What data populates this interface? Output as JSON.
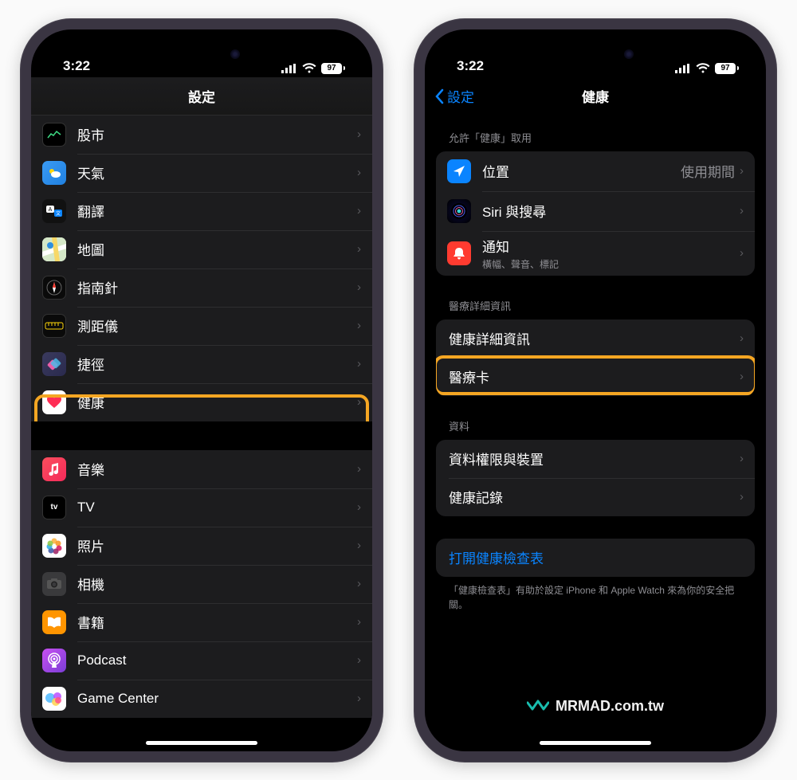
{
  "status": {
    "time": "3:22",
    "battery": "97"
  },
  "left": {
    "title": "設定",
    "group1": [
      {
        "id": "stocks",
        "label": "股市",
        "icon": "stocks"
      },
      {
        "id": "weather",
        "label": "天氣",
        "icon": "weather"
      },
      {
        "id": "translate",
        "label": "翻譯",
        "icon": "translate"
      },
      {
        "id": "maps",
        "label": "地圖",
        "icon": "maps"
      },
      {
        "id": "compass",
        "label": "指南針",
        "icon": "compass"
      },
      {
        "id": "measure",
        "label": "測距儀",
        "icon": "measure"
      },
      {
        "id": "shortcuts",
        "label": "捷徑",
        "icon": "shortcuts"
      },
      {
        "id": "health",
        "label": "健康",
        "icon": "health",
        "highlight": true
      }
    ],
    "group2": [
      {
        "id": "music",
        "label": "音樂",
        "icon": "music"
      },
      {
        "id": "tv",
        "label": "TV",
        "icon": "tv"
      },
      {
        "id": "photos",
        "label": "照片",
        "icon": "photos"
      },
      {
        "id": "camera",
        "label": "相機",
        "icon": "camera"
      },
      {
        "id": "books",
        "label": "書籍",
        "icon": "books"
      },
      {
        "id": "podcast",
        "label": "Podcast",
        "icon": "podcast"
      },
      {
        "id": "gamecenter",
        "label": "Game Center",
        "icon": "gamecenter"
      }
    ]
  },
  "right": {
    "back": "設定",
    "title": "健康",
    "section1": {
      "header": "允許「健康」取用",
      "items": [
        {
          "id": "location",
          "label": "位置",
          "value": "使用期間",
          "icon": "location"
        },
        {
          "id": "siri",
          "label": "Siri 與搜尋",
          "icon": "siri"
        },
        {
          "id": "notifications",
          "label": "通知",
          "sub": "橫幅、聲音、標記",
          "icon": "notif"
        }
      ]
    },
    "section2": {
      "header": "醫療詳細資訊",
      "items": [
        {
          "id": "healthdetails",
          "label": "健康詳細資訊"
        },
        {
          "id": "medicalid",
          "label": "醫療卡",
          "highlight": true
        }
      ]
    },
    "section3": {
      "header": "資料",
      "items": [
        {
          "id": "datadevices",
          "label": "資料權限與裝置"
        },
        {
          "id": "healthrecords",
          "label": "健康記錄"
        }
      ]
    },
    "section4": {
      "link": "打開健康檢查表",
      "footer": "「健康檢查表」有助於設定 iPhone 和 Apple Watch 來為你的安全把關。"
    }
  },
  "watermark": "MRMAD.com.tw"
}
